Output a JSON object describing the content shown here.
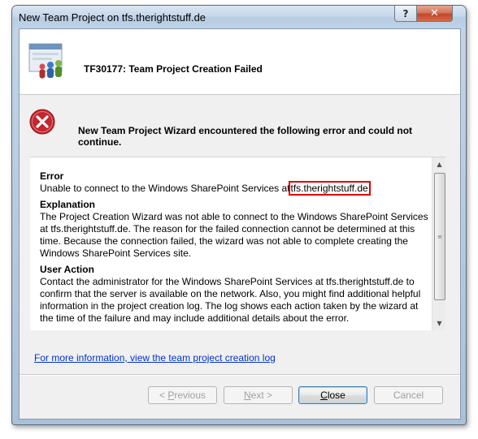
{
  "window": {
    "title": "New Team Project on tfs.therightstuff.de",
    "help_glyph": "?",
    "close_glyph": "✕"
  },
  "header": {
    "title": "TF30177: Team Project Creation Failed",
    "icon": "team-project-wizard-icon"
  },
  "error": {
    "icon": "error-x-icon",
    "message": "New Team Project Wizard encountered the following error and could not continue."
  },
  "details": {
    "error_heading": "Error",
    "error_text_prefix": "Unable to connect to the Windows SharePoint Services at",
    "error_server": "tfs.therightstuff.de",
    "explanation_heading": "Explanation",
    "explanation_text": "The Project Creation Wizard was not able to connect to the Windows SharePoint Services at tfs.therightstuff.de. The reason for the failed connection cannot be determined at this time. Because the connection failed, the wizard was not able to complete creating the Windows SharePoint Services site.",
    "user_action_heading": "User Action",
    "user_action_text": "Contact the administrator for the Windows SharePoint Services at tfs.therightstuff.de to confirm that the server is available on the network. Also, you might find additional helpful information in the project creation log. The log shows each action taken by the wizard at the time of the failure and may include additional details about the error."
  },
  "link": {
    "text": "For more information, view the team project creation log"
  },
  "buttons": {
    "previous": {
      "accel": "P",
      "rest": "revious",
      "prefix": "< "
    },
    "next": {
      "accel": "N",
      "rest": "ext >"
    },
    "close": {
      "accel": "C",
      "rest": "lose"
    },
    "cancel": {
      "label": "Cancel"
    }
  },
  "colors": {
    "highlight_border": "#e00000",
    "link": "#0033cc",
    "error_red": "#c4262e"
  }
}
